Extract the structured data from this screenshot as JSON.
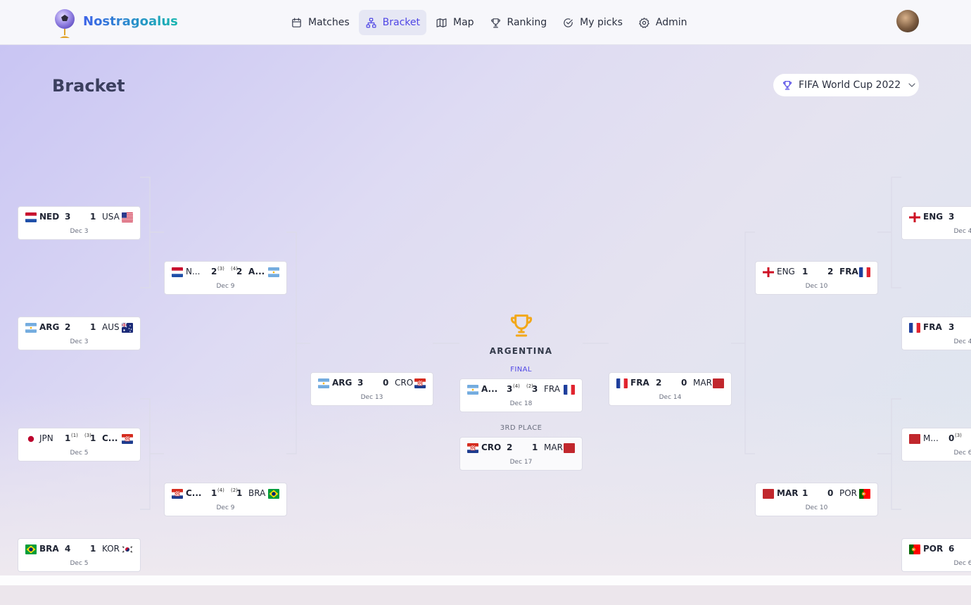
{
  "app": {
    "name": "Nostragoalus"
  },
  "nav": [
    {
      "label": "Matches",
      "icon": "calendar-icon",
      "active": false
    },
    {
      "label": "Bracket",
      "icon": "bracket-icon",
      "active": true
    },
    {
      "label": "Map",
      "icon": "map-icon",
      "active": false
    },
    {
      "label": "Ranking",
      "icon": "trophy-icon",
      "active": false
    },
    {
      "label": "My picks",
      "icon": "check-circle-icon",
      "active": false
    },
    {
      "label": "Admin",
      "icon": "gear-icon",
      "active": false
    }
  ],
  "page": {
    "title": "Bracket"
  },
  "tournament": {
    "selected": "FIFA World Cup 2022"
  },
  "champion": {
    "name": "ARGENTINA"
  },
  "labels": {
    "final": "FINAL",
    "third": "3RD PLACE"
  },
  "colors": {
    "accent": "#4f46e5",
    "trophy": "#f2a81b"
  },
  "matches": {
    "r16_1": {
      "home": {
        "code": "NED",
        "flag": "ned",
        "score": "3"
      },
      "away": {
        "code": "USA",
        "flag": "usa",
        "score": "1"
      },
      "winner": "home",
      "date": "Dec 3"
    },
    "r16_2": {
      "home": {
        "code": "ARG",
        "flag": "arg",
        "score": "2"
      },
      "away": {
        "code": "AUS",
        "flag": "aus",
        "score": "1"
      },
      "winner": "home",
      "date": "Dec 3"
    },
    "r16_3": {
      "home": {
        "code": "JPN",
        "flag": "jpn",
        "score": "1",
        "pen": "(1)"
      },
      "away": {
        "code": "C...",
        "flag": "cro",
        "score": "1",
        "pen": "(3)"
      },
      "winner": "away",
      "date": "Dec 5"
    },
    "r16_4": {
      "home": {
        "code": "BRA",
        "flag": "bra",
        "score": "4"
      },
      "away": {
        "code": "KOR",
        "flag": "kor",
        "score": "1"
      },
      "winner": "home",
      "date": "Dec 5"
    },
    "qf_1": {
      "home": {
        "code": "N...",
        "flag": "ned",
        "score": "2",
        "pen": "(3)"
      },
      "away": {
        "code": "A...",
        "flag": "arg",
        "score": "2",
        "pen": "(4)"
      },
      "winner": "away",
      "date": "Dec 9"
    },
    "qf_2": {
      "home": {
        "code": "C...",
        "flag": "cro",
        "score": "1",
        "pen": "(4)"
      },
      "away": {
        "code": "BRA",
        "flag": "bra",
        "score": "1",
        "pen": "(2)"
      },
      "winner": "home",
      "date": "Dec 9"
    },
    "sf_1": {
      "home": {
        "code": "ARG",
        "flag": "arg",
        "score": "3"
      },
      "away": {
        "code": "CRO",
        "flag": "cro",
        "score": "0"
      },
      "winner": "home",
      "date": "Dec 13"
    },
    "final": {
      "home": {
        "code": "A...",
        "flag": "arg",
        "score": "3",
        "pen": "(4)"
      },
      "away": {
        "code": "FRA",
        "flag": "fra",
        "score": "3",
        "pen": "(2)"
      },
      "winner": "home",
      "date": "Dec 18"
    },
    "third": {
      "home": {
        "code": "CRO",
        "flag": "cro",
        "score": "2"
      },
      "away": {
        "code": "MAR",
        "flag": "mar",
        "score": "1"
      },
      "winner": "home",
      "date": "Dec 17"
    },
    "sf_2": {
      "home": {
        "code": "FRA",
        "flag": "fra",
        "score": "2"
      },
      "away": {
        "code": "MAR",
        "flag": "mar",
        "score": "0"
      },
      "winner": "home",
      "date": "Dec 14"
    },
    "qf_3": {
      "home": {
        "code": "ENG",
        "flag": "eng",
        "score": "1"
      },
      "away": {
        "code": "FRA",
        "flag": "fra",
        "score": "2"
      },
      "winner": "away",
      "date": "Dec 10"
    },
    "qf_4": {
      "home": {
        "code": "MAR",
        "flag": "mar",
        "score": "1"
      },
      "away": {
        "code": "POR",
        "flag": "por",
        "score": "0"
      },
      "winner": "home",
      "date": "Dec 10"
    },
    "r16_5": {
      "home": {
        "code": "ENG",
        "flag": "eng",
        "score": "3"
      },
      "winner": "home",
      "date": "Dec 4"
    },
    "r16_6": {
      "home": {
        "code": "FRA",
        "flag": "fra",
        "score": "3"
      },
      "winner": "home",
      "date": "Dec 4"
    },
    "r16_7": {
      "home": {
        "code": "M...",
        "flag": "mar",
        "score": "0",
        "pen": "(3)"
      },
      "date": "Dec 6"
    },
    "r16_8": {
      "home": {
        "code": "POR",
        "flag": "por",
        "score": "6"
      },
      "winner": "home",
      "date": "Dec 6"
    }
  }
}
